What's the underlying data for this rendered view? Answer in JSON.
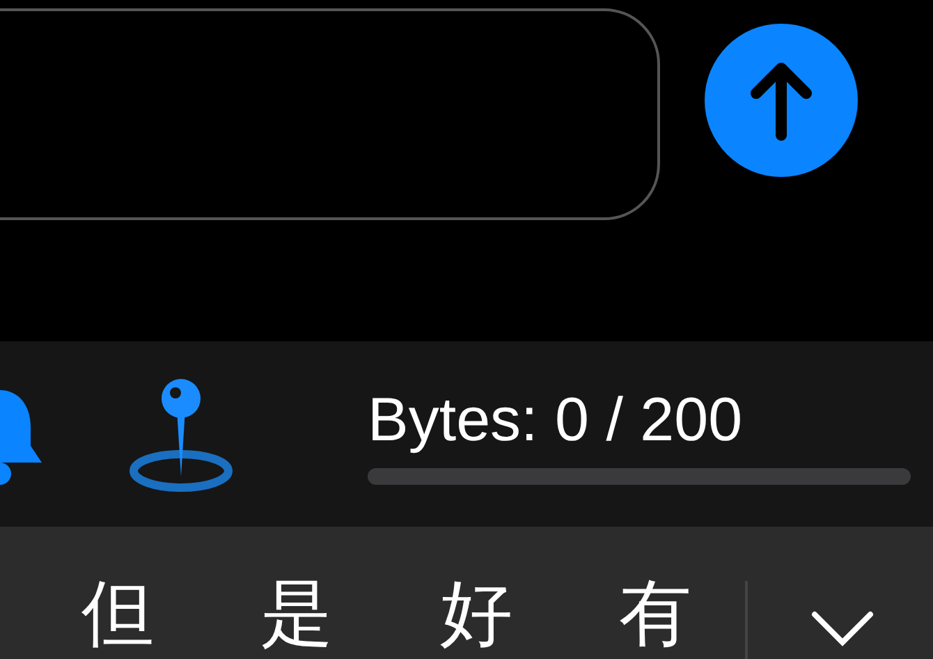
{
  "toolbar": {
    "byte_counter": "Bytes: 0 / 200",
    "level": 0
  },
  "candidates": [
    "但",
    "是",
    "好",
    "有"
  ]
}
